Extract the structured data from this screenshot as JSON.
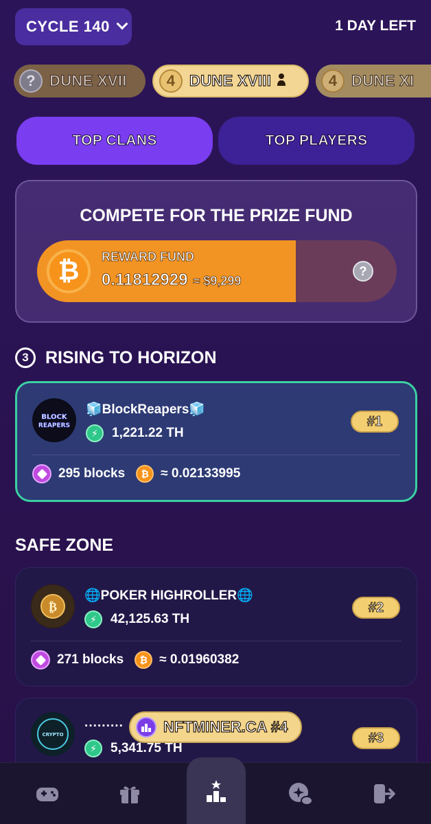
{
  "header": {
    "cycle_label": "CYCLE 140",
    "days_left": "1 DAY LEFT"
  },
  "dunes": {
    "prev": {
      "num": "?",
      "label": "DUNE XVII"
    },
    "current": {
      "num": "4",
      "label": "DUNE XVIII"
    },
    "next": {
      "num": "4",
      "label": "DUNE XI"
    }
  },
  "tabs": {
    "clans": "TOP CLANS",
    "players": "TOP PLAYERS"
  },
  "prize": {
    "title": "COMPETE FOR THE PRIZE FUND",
    "reward_label": "REWARD FUND",
    "reward_btc": "0.11812929",
    "reward_usd": "≈ $9,299",
    "help": "?"
  },
  "sections": {
    "rising": {
      "number": "3",
      "title": "RISING TO HORIZON"
    },
    "safe": {
      "title": "SAFE ZONE"
    }
  },
  "clans": [
    {
      "name": "🧊BlockReapers🧊",
      "power": "1,221.22 TH",
      "rank": "#1",
      "blocks": "295 blocks",
      "btc": "≈ 0.02133995",
      "avatar_text": "BLOCK REAPERS"
    },
    {
      "name": "🌐POKER HIGHROLLER🌐",
      "power": "42,125.63 TH",
      "rank": "#2",
      "blocks": "271 blocks",
      "btc": "≈ 0.01960382",
      "avatar_text": "₿"
    },
    {
      "name": "·········",
      "power": "5,341.75 TH",
      "rank": "#3",
      "avatar_text": "CRYPTO"
    }
  ],
  "toast": {
    "text": "NFTMINER.CA #4"
  },
  "nav": [
    {
      "name": "games",
      "icon": "gamepad-icon"
    },
    {
      "name": "shop",
      "icon": "gift-box-icon"
    },
    {
      "name": "leaderboard",
      "icon": "podium-icon"
    },
    {
      "name": "mining",
      "icon": "ore-icon"
    },
    {
      "name": "logout",
      "icon": "exit-icon"
    }
  ],
  "colors": {
    "accent": "#7a3df0",
    "highlight_border": "#3ad0a2",
    "gold": "#f4cf72",
    "btc": "#f7931a"
  }
}
